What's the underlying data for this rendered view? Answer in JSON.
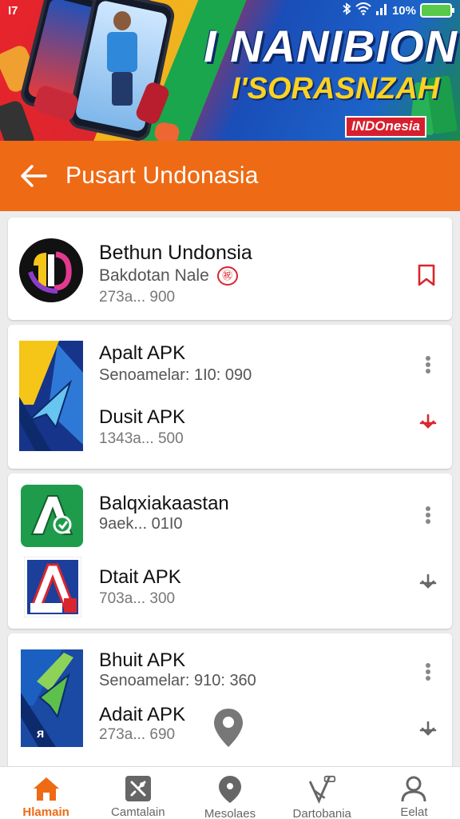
{
  "status_bar": {
    "left_text": "I7",
    "right_text": "10%",
    "icons": [
      "bluetooth-icon",
      "wifi-icon",
      "signal-icon",
      "battery-icon"
    ]
  },
  "banner": {
    "title": "I NANIBION",
    "subtitle": "I'SORASNZAH",
    "tag": "INDOnesia"
  },
  "header": {
    "title": "Pusart Undonasia",
    "back_icon": "arrow-left-icon"
  },
  "cards": [
    {
      "items": [
        {
          "title": "Bethun Undonsia",
          "subtitle": "Bakdotan Nale",
          "badge": "㊗",
          "meta": "273a... 900",
          "action_icon": "bookmark-icon"
        }
      ]
    },
    {
      "items": [
        {
          "title": "Apalt APK",
          "subtitle": "Senoamelar: 1I0: 090",
          "action_icon": "more-vertical-icon"
        },
        {
          "title": "Dusit APK",
          "meta": "1343a... 500",
          "action_icon": "download-icon"
        }
      ]
    },
    {
      "items": [
        {
          "title": "Balqxiakaastan",
          "subtitle": "9aek... 01I0",
          "action_icon": "more-vertical-icon"
        },
        {
          "title": "Dtait APK",
          "meta": "703a... 300",
          "action_icon": "download-icon"
        }
      ]
    },
    {
      "items": [
        {
          "title": "Bhuit APK",
          "subtitle": "Senoamelar: 910: 360",
          "action_icon": "more-vertical-icon"
        },
        {
          "title": "Adait APK",
          "meta": "273a... 690",
          "action_icon": "download-icon"
        }
      ]
    }
  ],
  "bottom_nav": [
    {
      "label": "Hlamain",
      "icon": "home-icon",
      "active": true
    },
    {
      "label": "Camtalain",
      "icon": "gallery-icon",
      "active": false
    },
    {
      "label": "Mesolaes",
      "icon": "location-pin-icon",
      "active": false
    },
    {
      "label": "Dartobania",
      "icon": "offers-icon",
      "active": false
    },
    {
      "label": "Eelat",
      "icon": "profile-icon",
      "active": false
    }
  ],
  "colors": {
    "accent": "#ee6a15",
    "danger": "#d9262e",
    "text": "#111111"
  }
}
